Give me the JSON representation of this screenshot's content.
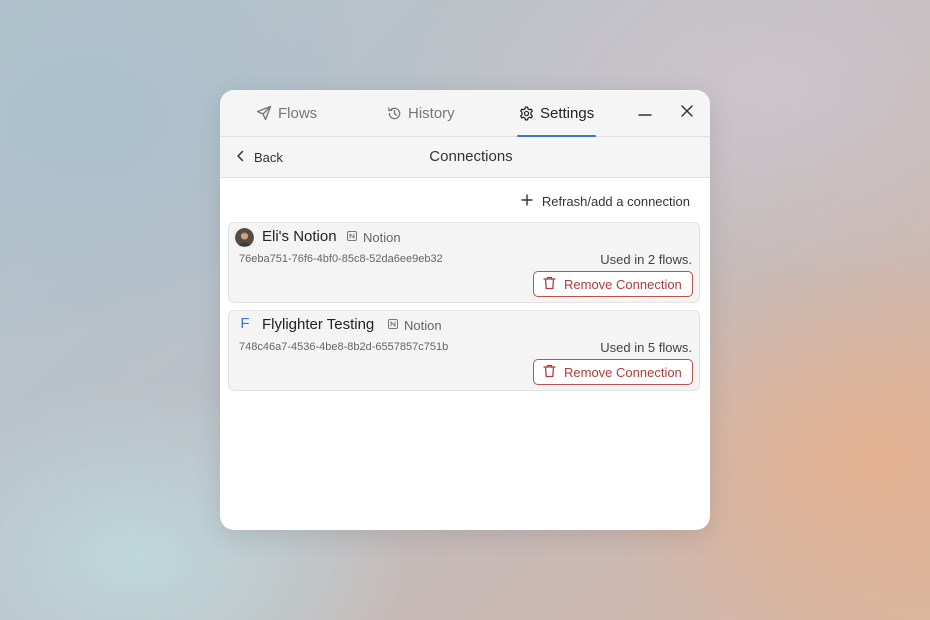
{
  "tabs": {
    "flows": {
      "label": "Flows",
      "icon": "send-icon"
    },
    "history": {
      "label": "History",
      "icon": "history-icon"
    },
    "settings": {
      "label": "Settings",
      "icon": "gear-icon"
    }
  },
  "active_tab": "settings",
  "window_controls": {
    "minimize": "minimize-icon",
    "close": "close-icon"
  },
  "subheader": {
    "back_label": "Back",
    "title": "Connections"
  },
  "refresh_label": "Refrash/add a connection",
  "connections": [
    {
      "name": "Eli's Notion",
      "service": "Notion",
      "id": "76eba751-76f6-4bf0-85c8-52da6ee9eb32",
      "usage": "Used in 2 flows.",
      "remove_label": "Remove Connection",
      "avatar": "avatar-photo"
    },
    {
      "name": "Flylighter Testing",
      "service": "Notion",
      "id": "748c46a7-4536-4be8-8b2d-6557857c751b",
      "usage": "Used in 5 flows.",
      "remove_label": "Remove Connection",
      "avatar_letter": "F"
    }
  ],
  "colors": {
    "accent": "#3a78c9",
    "danger": "#b23b3b",
    "card_bg": "#f4f4f4"
  }
}
